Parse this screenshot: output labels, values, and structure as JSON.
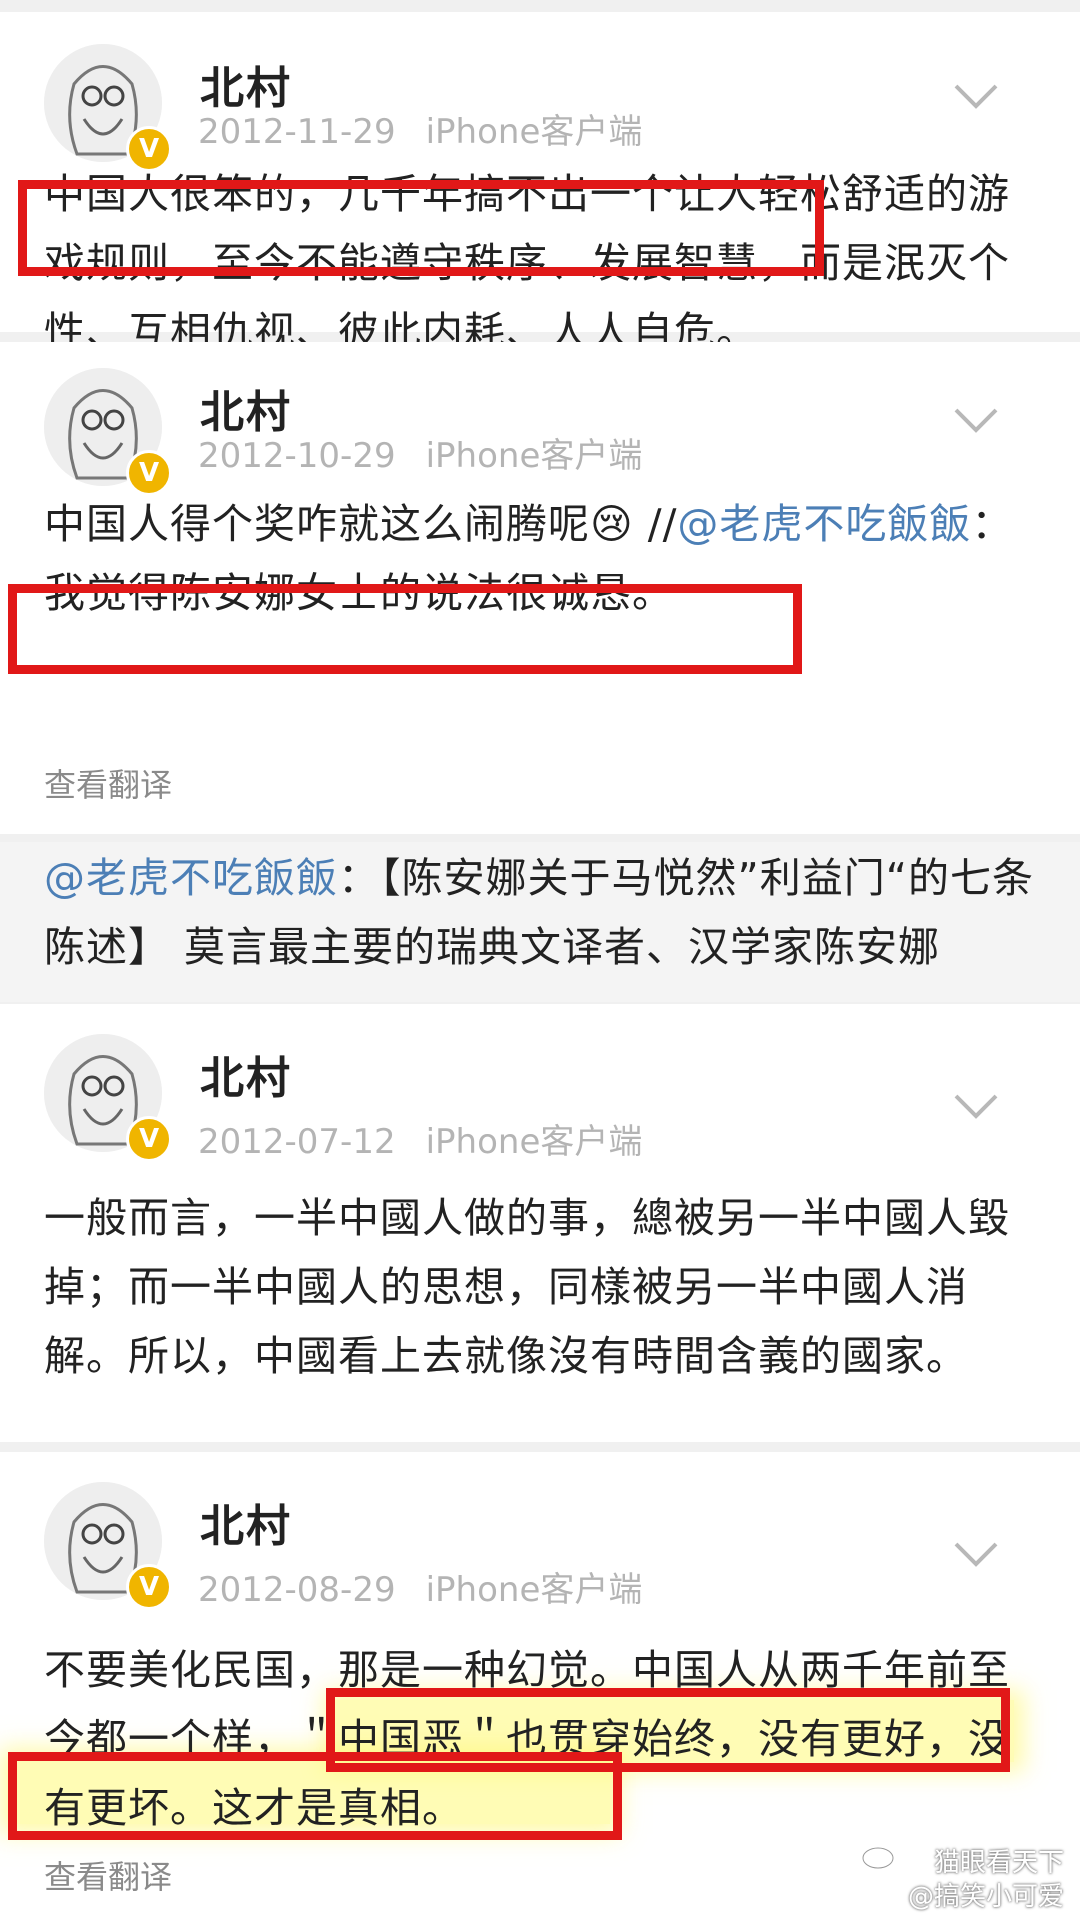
{
  "posts": [
    {
      "author": "北村",
      "date": "2012-11-29",
      "source": "iPhone客户端",
      "text": "中国人很笨的，几千年搞不出一个让人轻松舒适的游戏规则，至今不能遵守秩序、发展智慧，而是泯灭个性、互相仇视、彼此内耗、人人自危。"
    },
    {
      "author": "北村",
      "date": "2012-10-29",
      "source": "iPhone客户端",
      "text_before_mention": "中国人得个奖咋就这么闹腾呢",
      "emoji": "😢",
      "slashes": " //",
      "mention": "@老虎不吃飯飯",
      "text_after_mention": "：我觉得陈安娜女士的说法很诚恳。",
      "translate_label": "查看翻译",
      "quoted": {
        "mention": "@老虎不吃飯飯",
        "text": "：【陈安娜关于马悦然”利益门“的七条陈述】 莫言最主要的瑞典文译者、汉学家陈安娜"
      }
    },
    {
      "author": "北村",
      "date": "2012-07-12",
      "source": "iPhone客户端",
      "text": "一般而言，一半中國人做的事，總被另一半中國人毀掉；而一半中國人的思想，同樣被另一半中國人消解。所以，中國看上去就像沒有時間含義的國家。"
    },
    {
      "author": "北村",
      "date": "2012-08-29",
      "source": "iPhone客户端",
      "text": "不要美化民国，那是一种幻觉。中国人从两千年前至今都一个样，＂中国恶＂也贯穿始终，没有更好，没有更坏。这才是真相。",
      "translate_label": "查看翻译"
    }
  ],
  "watermark": {
    "line1": "猫眼看天下",
    "line2": "@搞笑小可爱"
  },
  "icons": {
    "verified": "verified-v-badge",
    "chevron": "chevron-down-icon",
    "weibo": "weibo-logo-icon"
  },
  "colors": {
    "link": "#4c7fb6",
    "annotation_red": "#e11818",
    "highlight_yellow": "#fff578",
    "verified": "#f0b500"
  }
}
